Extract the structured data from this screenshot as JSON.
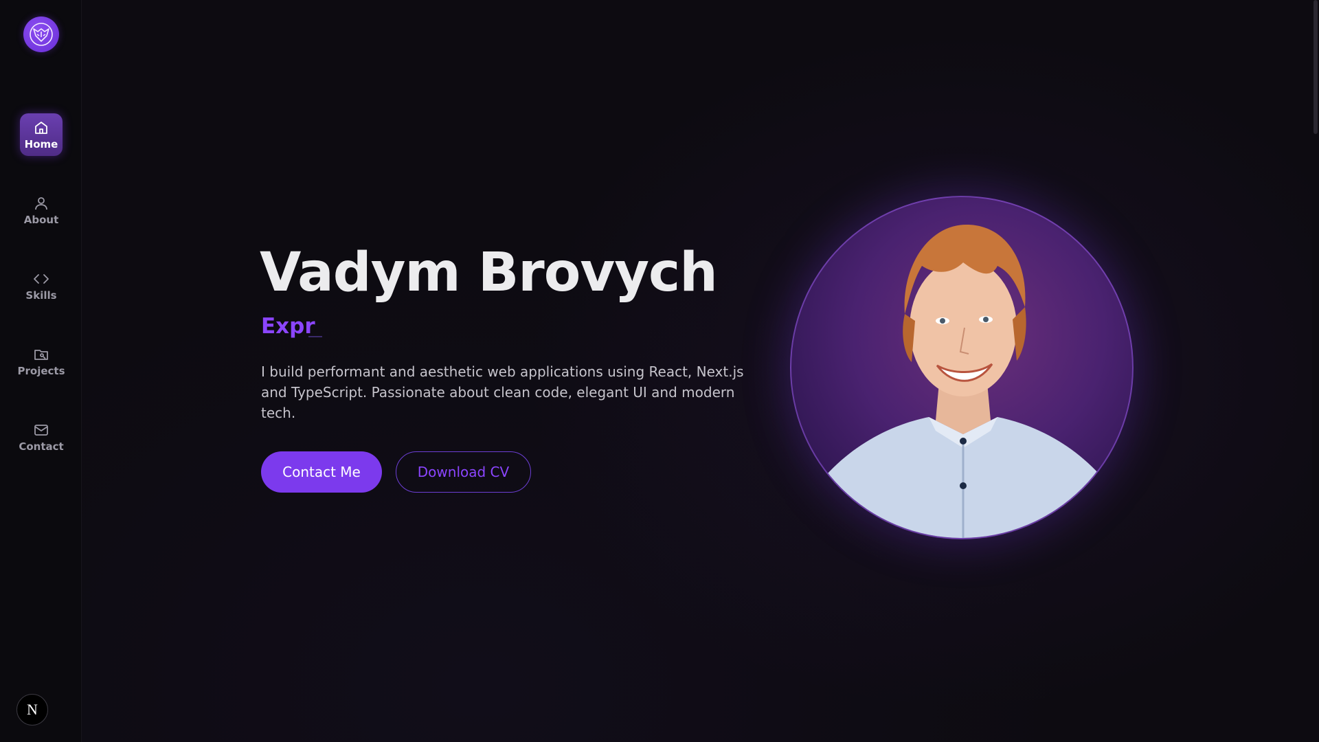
{
  "sidebar": {
    "items": [
      {
        "label": "Home",
        "icon": "home-icon",
        "active": true
      },
      {
        "label": "About",
        "icon": "user-icon",
        "active": false
      },
      {
        "label": "Skills",
        "icon": "code-icon",
        "active": false
      },
      {
        "label": "Projects",
        "icon": "folder-icon",
        "active": false
      },
      {
        "label": "Contact",
        "icon": "mail-icon",
        "active": false
      }
    ],
    "badge": "N"
  },
  "hero": {
    "name": "Vadym Brovych",
    "typed_text": "Expr",
    "bio": "I build performant and aesthetic web applications using React, Next.js and TypeScript. Passionate about clean code, elegant UI and modern tech.",
    "primary_button": "Contact Me",
    "secondary_button": "Download CV"
  },
  "colors": {
    "accent": "#7c3aed",
    "accent_text": "#8b45ff",
    "background": "#0d0b11"
  }
}
